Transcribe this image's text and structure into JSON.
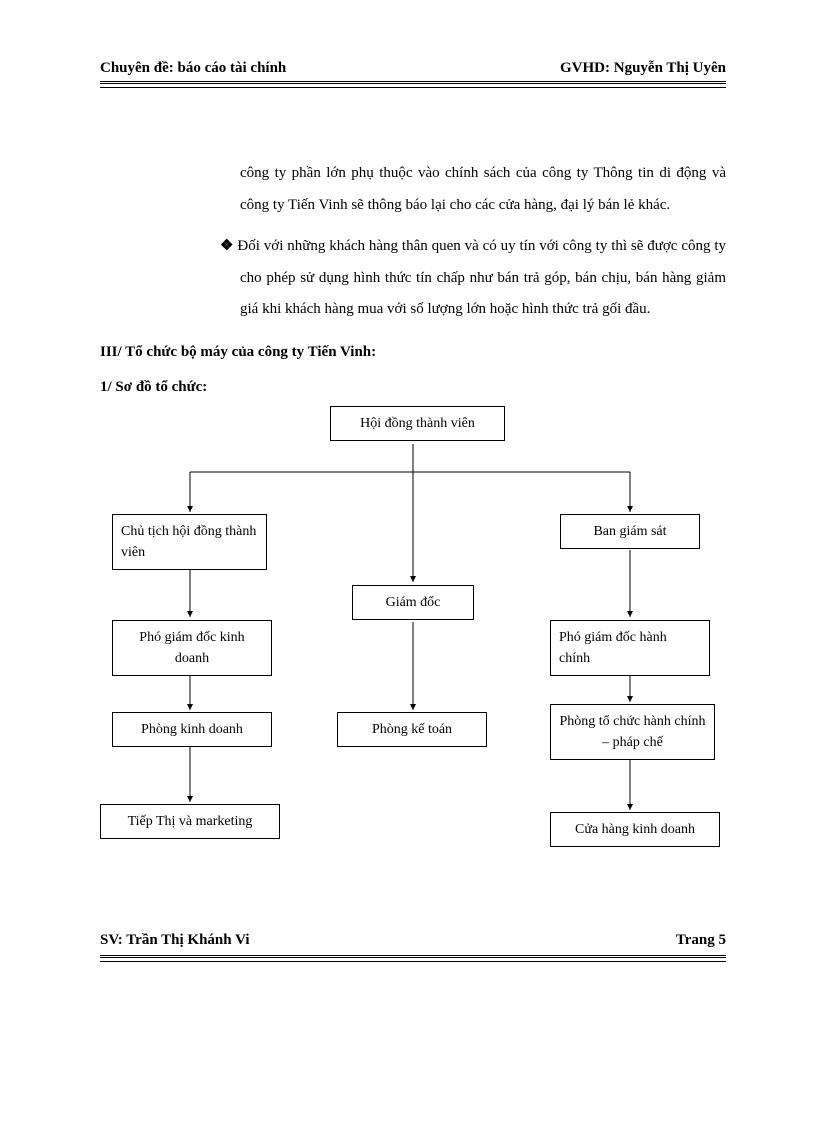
{
  "header": {
    "left": "Chuyên đề: báo cáo tài chính",
    "right": "GVHD: Nguyễn Thị Uyên"
  },
  "para1": "công ty phần lớn phụ thuộc vào chính sách của công ty Thông tin di động và công ty Tiến Vinh sẽ thông báo lại cho các cửa hàng, đại lý bán lẻ khác.",
  "bullet2": "Đối với những khách hàng thân quen và có uy tín với công ty thì sẽ được công ty cho phép sử dụng hình thức tín chấp như bán trả góp, bán chịu, bán hàng giảm giá khi khách hàng mua với số lượng lớn hoặc hình thức trả gối đầu.",
  "section_heading": "III/ Tổ chức bộ máy của công ty Tiến Vinh:",
  "sub_heading": "1/ Sơ đồ tổ chức:",
  "nodes": {
    "top": "Hội đồng thành viên",
    "leftA": "Chủ tịch hội đồng thành viên",
    "rightA": "Ban giám sát",
    "mid": "Giám đốc",
    "leftB": "Phó giám đốc kinh doanh",
    "rightB": "Phó giám đốc hành chính",
    "leftC": "Phòng kinh doanh",
    "midC": "Phòng kế toán",
    "rightC": "Phòng tổ chức hành chính – pháp chế",
    "leftD": "Tiếp Thị và marketing",
    "rightD": "Cửa hàng kinh doanh"
  },
  "footer": {
    "left": "SV: Trần Thị Khánh Vi",
    "right_prefix": "Trang ",
    "page": "5"
  }
}
